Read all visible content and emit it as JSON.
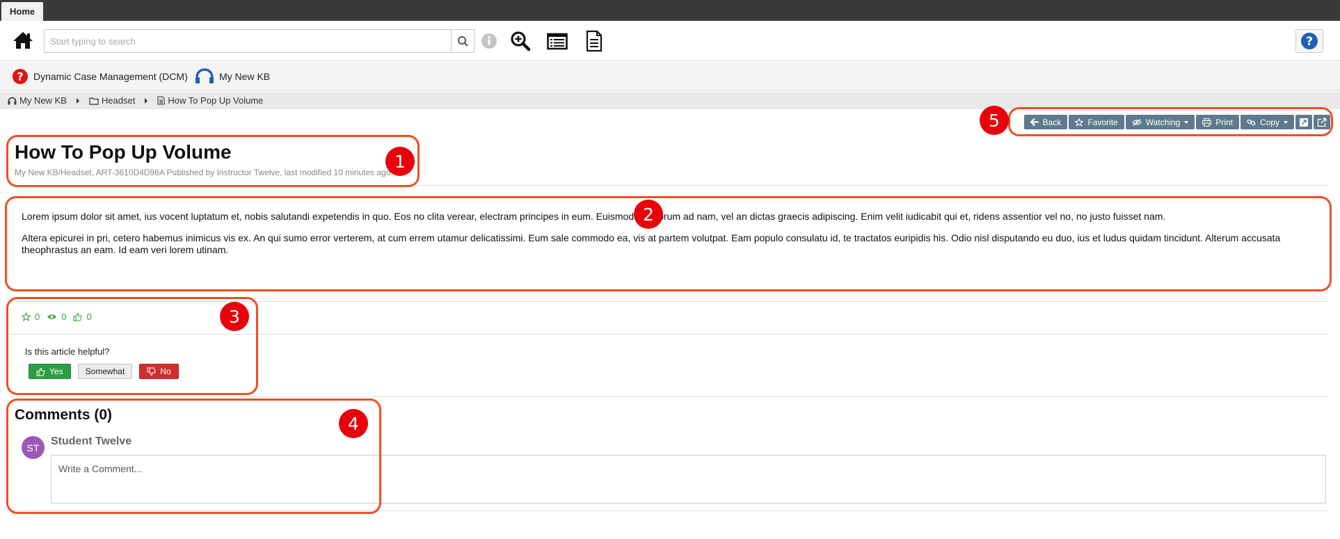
{
  "tabs": [
    {
      "label": "Home"
    }
  ],
  "toolbar": {
    "search_placeholder": "Start typing to search"
  },
  "kb_links": [
    {
      "label": "Dynamic Case Management (DCM)",
      "icon": "question-circle-icon",
      "color": "#e01414"
    },
    {
      "label": "My New KB",
      "icon": "headset-icon",
      "color": "#1f5fb8"
    }
  ],
  "breadcrumb": [
    {
      "label": "My New KB",
      "icon": "headset-icon"
    },
    {
      "label": "Headset",
      "icon": "folder-icon"
    },
    {
      "label": "How To Pop Up Volume",
      "icon": "document-icon"
    }
  ],
  "actions": {
    "back": "Back",
    "favorite": "Favorite",
    "watching": "Watching",
    "print": "Print",
    "copy": "Copy"
  },
  "article": {
    "title": "How To Pop Up Volume",
    "subtitle": "My New KB/Headset, ART-3610D4D96A Published by Instructor Twelve, last modified 10 minutes ago",
    "paragraphs": [
      "Lorem ipsum dolor sit amet, ius vocent luptatum et, nobis salutandi expetendis in quo. Eos no clita verear, electram principes in eum. Euismod atomorum ad nam, vel an dictas graecis adipiscing. Enim velit iudicabit qui et, ridens assentior vel no, no justo fuisset nam.",
      "Altera epicurei in pri, cetero habemus inimicus vis ex. An qui sumo error verterem, at cum errem utamur delicatissimi. Eum sale commodo ea, vis at partem volutpat. Eam populo consulatu id, te tractatos euripidis his. Odio nisl disputando eu duo, ius et ludus quidam tincidunt. Alterum accusata theophrastus an eam. Id eam veri lorem utinam."
    ]
  },
  "stats": {
    "favorites": "0",
    "views": "0",
    "likes": "0"
  },
  "feedback": {
    "question": "Is this article helpful?",
    "yes": "Yes",
    "somewhat": "Somewhat",
    "no": "No"
  },
  "comments": {
    "title": "Comments (0)",
    "user_initials": "ST",
    "user_name": "Student Twelve",
    "placeholder": "Write a Comment..."
  },
  "annotations": [
    "1",
    "2",
    "3",
    "4",
    "5"
  ],
  "colors": {
    "annotation": "#f04e23",
    "badge": "#e8000a",
    "action_button": "#5f7a8c",
    "yes": "#2e9e45",
    "no": "#cf2f2f",
    "stats": "#3a9e3a",
    "avatar": "#9b59b6"
  }
}
